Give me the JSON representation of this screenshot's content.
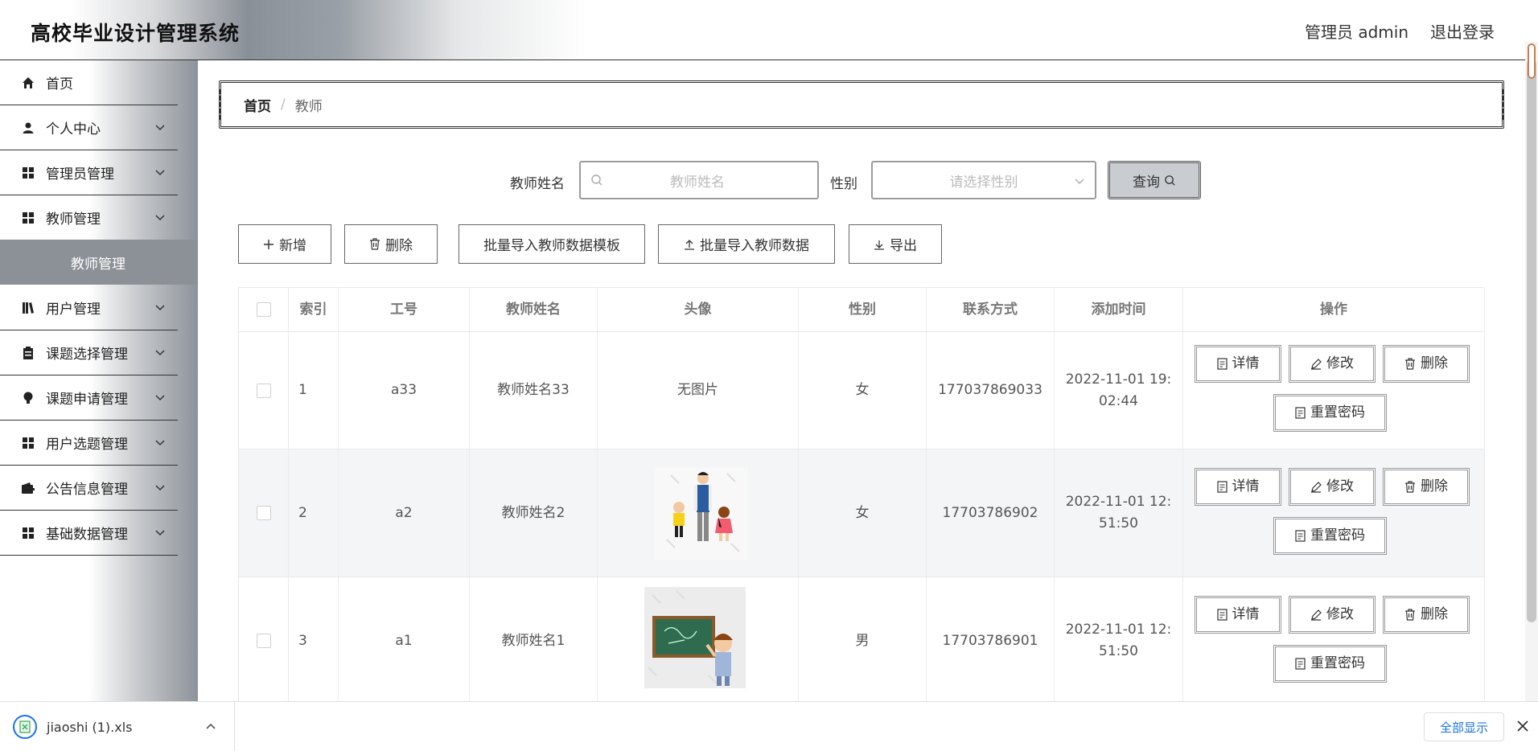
{
  "header": {
    "title": "高校毕业设计管理系统",
    "user": "管理员 admin",
    "logout": "退出登录"
  },
  "sidebar": {
    "items": [
      {
        "label": "首页",
        "icon": "home-icon"
      },
      {
        "label": "个人中心",
        "icon": "user-icon"
      },
      {
        "label": "管理员管理",
        "icon": "grid-icon"
      },
      {
        "label": "教师管理",
        "icon": "grid-icon"
      },
      {
        "label": "用户管理",
        "icon": "book-icon"
      },
      {
        "label": "课题选择管理",
        "icon": "clipboard-icon"
      },
      {
        "label": "课题申请管理",
        "icon": "bulb-icon"
      },
      {
        "label": "用户选题管理",
        "icon": "grid-icon"
      },
      {
        "label": "公告信息管理",
        "icon": "wallet-icon"
      },
      {
        "label": "基础数据管理",
        "icon": "grid-icon"
      }
    ],
    "submenu": "教师管理"
  },
  "breadcrumb": {
    "home": "首页",
    "sep": "/",
    "current": "教师"
  },
  "search": {
    "name_label": "教师姓名",
    "name_placeholder": "教师姓名",
    "gender_label": "性别",
    "gender_placeholder": "请选择性别",
    "query": "查询"
  },
  "toolbar": {
    "add": "新增",
    "delete": "删除",
    "template": "批量导入教师数据模板",
    "import": "批量导入教师数据",
    "export": "导出"
  },
  "table": {
    "headers": [
      "索引",
      "工号",
      "教师姓名",
      "头像",
      "性别",
      "联系方式",
      "添加时间",
      "操作"
    ],
    "rows": [
      {
        "index": "1",
        "code": "a33",
        "name": "教师姓名33",
        "avatar": "无图片",
        "gender": "女",
        "phone": "177037869033",
        "time1": "2022-11-01 19:",
        "time2": "02:44"
      },
      {
        "index": "2",
        "code": "a2",
        "name": "教师姓名2",
        "avatar": "",
        "gender": "女",
        "phone": "17703786902",
        "time1": "2022-11-01 12:",
        "time2": "51:50"
      },
      {
        "index": "3",
        "code": "a1",
        "name": "教师姓名1",
        "avatar": "",
        "gender": "男",
        "phone": "17703786901",
        "time1": "2022-11-01 12:",
        "time2": "51:50"
      }
    ],
    "ops": {
      "detail": "详情",
      "edit": "修改",
      "delete": "删除",
      "reset": "重置密码"
    }
  },
  "download": {
    "file": "jiaoshi (1).xls",
    "show_all": "全部显示"
  }
}
